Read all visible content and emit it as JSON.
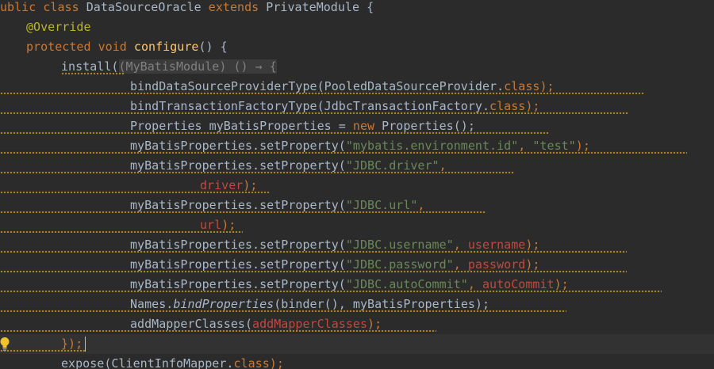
{
  "editor": {
    "lines": {
      "l1": {
        "t1": "ublic class",
        "t2": " DataSourceOracle ",
        "t3": "extends",
        "t4": " PrivateModule {"
      },
      "l2": {
        "ann": "@Override"
      },
      "l3": {
        "kw": "protected void",
        "fn": "configure",
        "rest": "() {"
      },
      "l4": {
        "call": "install(",
        "hint": "(MyBatisModule) () → {"
      },
      "l5": {
        "a": "bindDataSourceProviderType(PooledDataSourceProvider.",
        "kw": "class",
        "b": ");"
      },
      "l6": {
        "a": "bindTransactionFactoryType(JdbcTransactionFactory.",
        "kw": "class",
        "b": ");"
      },
      "l7": {
        "a": "Properties myBatisProperties = ",
        "kw": "new",
        "b": " Properties();"
      },
      "l8": {
        "a": "myBatisProperties.setProperty(",
        "s1": "\"mybatis.environment.id\"",
        "c": ", ",
        "s2": "\"test\"",
        "b": ");"
      },
      "l9": {
        "a": "myBatisProperties.setProperty(",
        "s1": "\"JDBC.driver\"",
        "b": ","
      },
      "l10": {
        "f": "driver",
        "b": ");"
      },
      "l11": {
        "a": "myBatisProperties.setProperty(",
        "s1": "\"JDBC.url\"",
        "b": ","
      },
      "l12": {
        "f": "url",
        "b": ");"
      },
      "l13": {
        "a": "myBatisProperties.setProperty(",
        "s1": "\"JDBC.username\"",
        "c": ", ",
        "f": "username",
        "b": ");"
      },
      "l14": {
        "a": "myBatisProperties.setProperty(",
        "s1": "\"JDBC.password\"",
        "c": ", ",
        "f": "password",
        "b": ");"
      },
      "l15": {
        "a": "myBatisProperties.setProperty(",
        "s1": "\"JDBC.autoCommit\"",
        "c": ", ",
        "f": "autoCommit",
        "b": ");"
      },
      "l16": {
        "a": "Names.",
        "it": "bindProperties",
        "b": "(binder(), myBatisProperties);"
      },
      "l17": {
        "a": "addMapperClasses(",
        "f": "addMapperClasses",
        "b": ");"
      },
      "l18": {
        "a": "});"
      },
      "l19": {
        "a": "expose(ClientInfoMapper.",
        "kw": "class",
        "b": ");"
      }
    }
  },
  "colors": {
    "background": "#2b2b2b",
    "current_line": "#323232",
    "text": "#a9b7c6",
    "keyword": "#cc7832",
    "string": "#6a8759",
    "field": "#c1493f",
    "annotation": "#bbb529",
    "method_decl": "#ffc66d",
    "warning_underline": "#be9117"
  },
  "icons": [
    "intention-bulb-icon"
  ]
}
